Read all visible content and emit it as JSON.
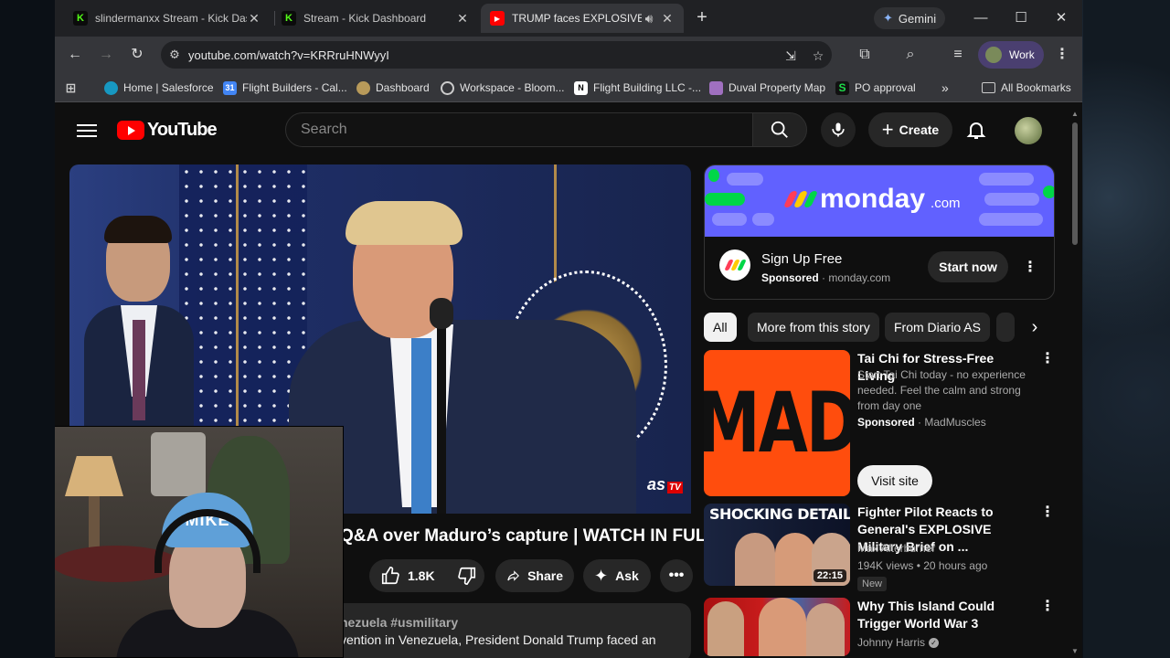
{
  "browser": {
    "tabs": [
      {
        "title": "slindermanxx Stream - Kick Dashboard",
        "favicon": "kick-icon"
      },
      {
        "title": "Stream - Kick Dashboard",
        "favicon": "kick-icon"
      },
      {
        "title": "TRUMP faces EXPLOSIVE PRESS",
        "favicon": "youtube-icon",
        "active": true
      }
    ],
    "gemini_label": "Gemini",
    "url": "youtube.com/watch?v=KRRruHNWyyI",
    "profile_label": "Work",
    "bookmarks": [
      {
        "label": "Home | Salesforce",
        "icon": "salesforce-icon",
        "color": "#1798c1"
      },
      {
        "label": "Flight Builders - Cal...",
        "icon": "calendar-icon",
        "color": "#4285f4"
      },
      {
        "label": "Dashboard",
        "icon": "dashboard-icon",
        "color": "#b89a5a"
      },
      {
        "label": "Workspace - Bloom...",
        "icon": "workspace-icon",
        "color": "#777777"
      },
      {
        "label": "Flight Building LLC -...",
        "icon": "notion-icon",
        "color": "#ffffff"
      },
      {
        "label": "Duval Property Map",
        "icon": "map-icon",
        "color": "#a070c0"
      },
      {
        "label": "PO approval",
        "icon": "sheet-icon",
        "color": "#111111"
      }
    ],
    "all_bookmarks_label": "All Bookmarks"
  },
  "youtube": {
    "search_placeholder": "Search",
    "create_label": "Create",
    "video": {
      "title": "Q&A over Maduro’s capture | WATCH IN FULL",
      "title_visible": "Q&A over Maduro’s capture | WATCH IN FULL",
      "likes": "1.8K",
      "share_label": "Share",
      "ask_label": "Ask",
      "watermark": "as",
      "watermark_badge": "TV",
      "desc_tags": "nezuela #usmilitary",
      "desc_line1": "vention in Venezuela, President Donald Trump faced an",
      "desc_line2": ""
    },
    "webcam_cap_text": "MIKE",
    "ad": {
      "brand": "monday",
      "brand_suffix": ".com",
      "title": "Sign Up Free",
      "sponsored": "Sponsored",
      "domain": "monday.com",
      "cta": "Start now",
      "colors": [
        "#ff3d57",
        "#ffcb00",
        "#00d647"
      ]
    },
    "chips": [
      "All",
      "More from this story",
      "From Diario AS"
    ],
    "recommendations": [
      {
        "type": "ad",
        "title": "Tai Chi for Stress-Free Living",
        "desc": [
          "Start Tai Chi today - no experience",
          "needed. Feel the calm and strong",
          "from day one"
        ],
        "sponsored": "Sponsored",
        "advertiser": "MadMuscles",
        "thumb_text": "MAD",
        "cta": "Visit site"
      },
      {
        "title": "Fighter Pilot Reacts to General's EXPLOSIVE Military Brief on ...",
        "channel": "Max Afterburner",
        "meta": "194K views • 20 hours ago",
        "badge": "New",
        "thumb_text": "SHOCKING DETAILS",
        "duration": "22:15"
      },
      {
        "title": "Why This Island Could Trigger World War 3",
        "channel": "Johnny Harris",
        "verified": true
      }
    ]
  }
}
